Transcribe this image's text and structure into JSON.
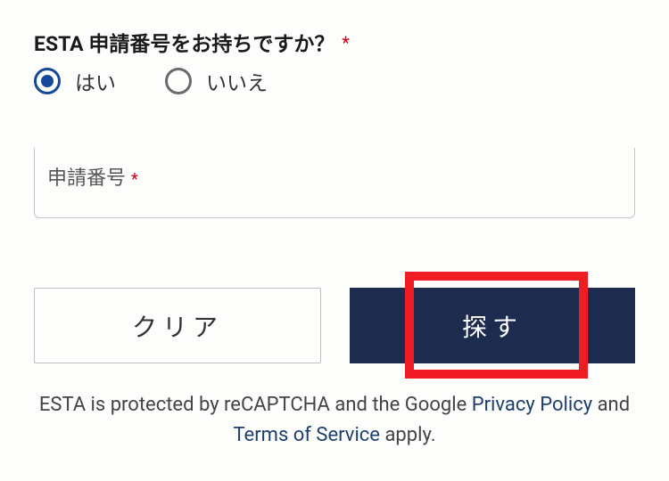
{
  "question": {
    "label": "ESTA 申請番号をお持ちですか？",
    "required_marker": "*",
    "options": {
      "yes": "はい",
      "no": "いいえ"
    }
  },
  "input": {
    "label": "申請番号",
    "required_marker": "*"
  },
  "buttons": {
    "clear": "クリア",
    "search": "探す"
  },
  "footer": {
    "part1": "ESTA is protected by reCAPTCHA and the Google ",
    "privacy": "Privacy Policy",
    "part2": " and ",
    "tos": "Terms of Service",
    "part3": " apply."
  }
}
